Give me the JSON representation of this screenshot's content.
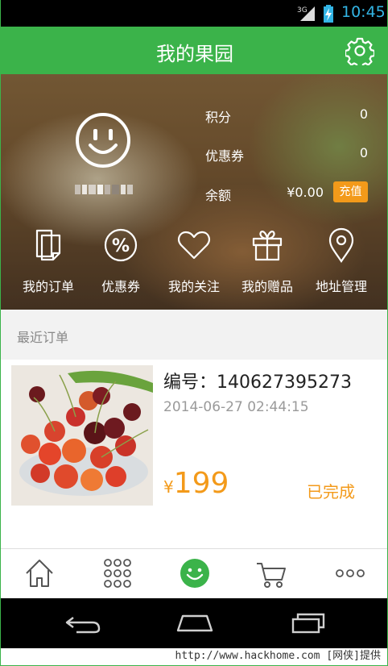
{
  "status_bar": {
    "network": "3G",
    "time": "10:45"
  },
  "header": {
    "title": "我的果园",
    "settings_icon": "gear-icon"
  },
  "profile": {
    "avatar_icon": "smiley-face-icon",
    "stats": [
      {
        "label": "积分",
        "value": "0"
      },
      {
        "label": "优惠券",
        "value": "0"
      },
      {
        "label": "余额",
        "value": "¥0.00",
        "action": "充值"
      }
    ]
  },
  "quick_nav": [
    {
      "label": "我的订单",
      "icon": "order-document-icon"
    },
    {
      "label": "优惠券",
      "icon": "percent-coupon-icon"
    },
    {
      "label": "我的关注",
      "icon": "heart-icon"
    },
    {
      "label": "我的赠品",
      "icon": "gift-icon"
    },
    {
      "label": "地址管理",
      "icon": "location-pin-icon"
    }
  ],
  "recent_orders": {
    "label": "最近订单",
    "orders": [
      {
        "number": "编号：140627395273",
        "date": "2014-06-27 02:44:15",
        "currency": "¥",
        "price": "199",
        "status": "已完成",
        "image": "cherries-photo"
      }
    ]
  },
  "bottom_tabs": [
    {
      "icon": "home-icon"
    },
    {
      "icon": "grid-dots-icon"
    },
    {
      "icon": "smiley-face-icon",
      "active": true
    },
    {
      "icon": "cart-icon"
    },
    {
      "icon": "more-dots-icon"
    }
  ],
  "colors": {
    "brand_green": "#3bb34a",
    "accent_orange": "#f39a1a",
    "time_blue": "#33b5e5"
  },
  "system_nav": [
    "back-icon",
    "home-icon",
    "recent-apps-icon"
  ],
  "watermark": "http://www.hackhome.com [网侠]提供"
}
